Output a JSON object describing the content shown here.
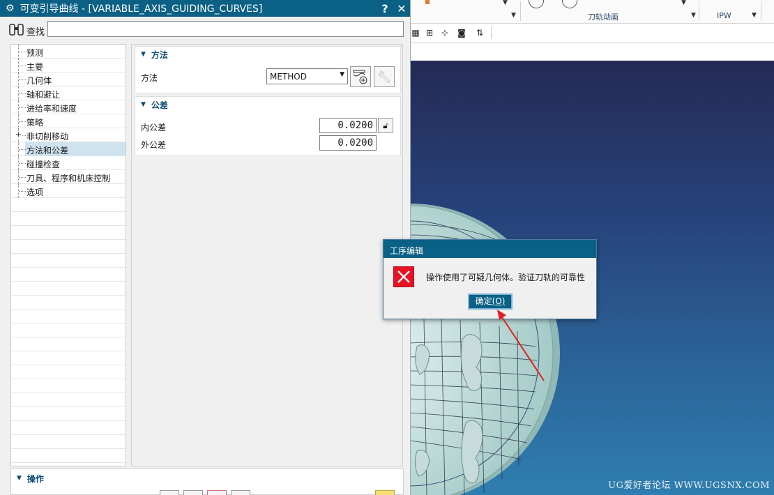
{
  "dialog": {
    "title": "可变引导曲线 - [VARIABLE_AXIS_GUIDING_CURVES]",
    "help_label": "?",
    "close_label": "✕",
    "find_label": "查找",
    "find_value": ""
  },
  "nav": {
    "items": [
      {
        "label": "预测"
      },
      {
        "label": "主要"
      },
      {
        "label": "几何体"
      },
      {
        "label": "轴和避让"
      },
      {
        "label": "进给率和速度"
      },
      {
        "label": "策略"
      },
      {
        "label": "非切削移动",
        "expandable": true
      },
      {
        "label": "方法和公差",
        "selected": true
      },
      {
        "label": "碰撞检查"
      },
      {
        "label": "刀具、程序和机床控制"
      },
      {
        "label": "选项"
      }
    ]
  },
  "method_group": {
    "header": "方法",
    "method_label": "方法",
    "method_value": "METHOD"
  },
  "tolerance_group": {
    "header": "公差",
    "inner_label": "内公差",
    "inner_value": "0.0200",
    "outer_label": "外公差",
    "outer_value": "0.0200"
  },
  "operations": {
    "header": "操作"
  },
  "background_app": {
    "ribbon_group_label": "刀轨动画",
    "ipw_label": "IPW",
    "watermark": "UG爱好者论坛 WWW.UGSNX.COM"
  },
  "error_dialog": {
    "title": "工序编辑",
    "message": "操作使用了可疑几何体。验证刀轨的可靠性",
    "ok_label": "确定",
    "ok_accel": "(O)"
  },
  "colors": {
    "title_bar": "#0a6085",
    "group_header_text": "#0e4c74",
    "selected_row": "#cfe2ef",
    "error_icon": "#e81123",
    "arrow": "#e02020"
  }
}
